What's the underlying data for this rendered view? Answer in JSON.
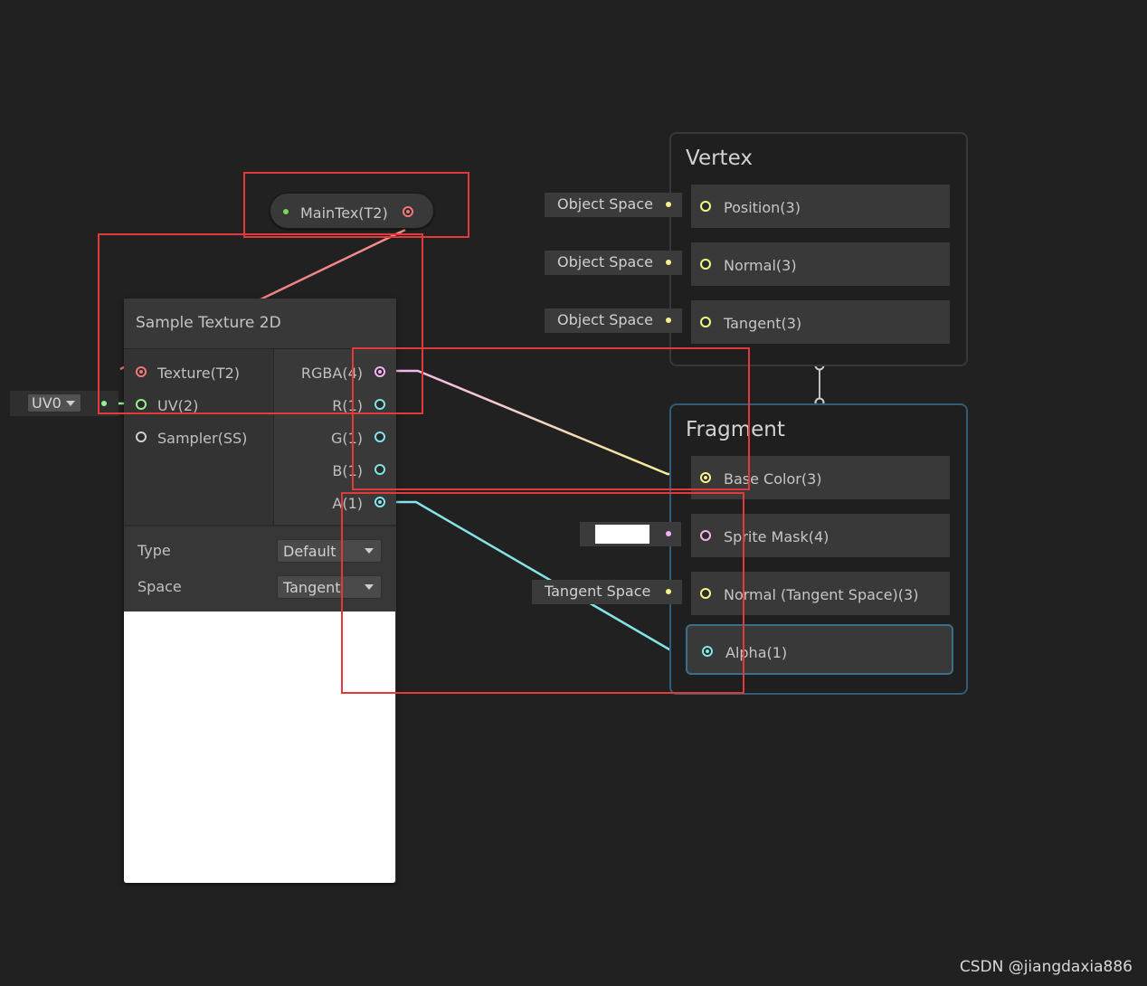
{
  "property_node": {
    "label": "MainTex(T2)",
    "color": "#f07878"
  },
  "sample_texture": {
    "title": "Sample Texture 2D",
    "inputs": [
      "Texture(T2)",
      "UV(2)",
      "Sampler(SS)"
    ],
    "outputs": [
      "RGBA(4)",
      "R(1)",
      "G(1)",
      "B(1)",
      "A(1)"
    ],
    "settings": [
      {
        "label": "Type",
        "value": "Default"
      },
      {
        "label": "Space",
        "value": "Tangent"
      }
    ]
  },
  "uv_input": {
    "value": "UV0"
  },
  "vertex": {
    "title": "Vertex",
    "blocks": [
      {
        "label": "Position(3)",
        "space": "Object Space"
      },
      {
        "label": "Normal(3)",
        "space": "Object Space"
      },
      {
        "label": "Tangent(3)",
        "space": "Object Space"
      }
    ]
  },
  "fragment": {
    "title": "Fragment",
    "blocks": [
      {
        "label": "Base Color(3)"
      },
      {
        "label": "Sprite Mask(4)"
      },
      {
        "label": "Normal (Tangent Space)(3)",
        "space": "Tangent Space"
      },
      {
        "label": "Alpha(1)"
      }
    ]
  },
  "colors": {
    "texture_port": "#f07878",
    "vector4_port": "#f3b3f3",
    "vector3_port": "#f6f58a",
    "vector1_port": "#84e4e7",
    "vector2_port": "#9aef92",
    "highlight": "#e23a3a",
    "fragment_border": "#2f5d78"
  },
  "watermark": "CSDN @jiangdaxia886"
}
